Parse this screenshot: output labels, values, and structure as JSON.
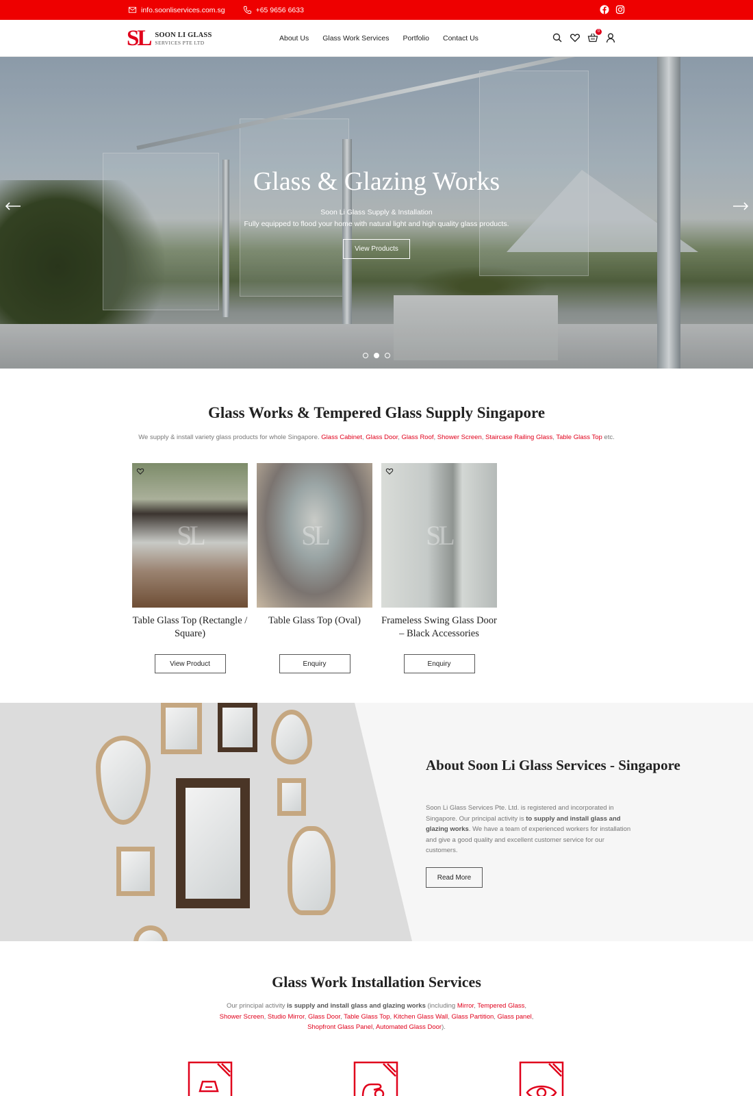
{
  "topbar": {
    "email": "info.soonliservices.com.sg",
    "phone": "+65 9656 6633",
    "social": [
      "facebook-icon",
      "instagram-icon"
    ]
  },
  "header": {
    "logo_mark": "SL",
    "logo_line1": "SOON LI GLASS",
    "logo_line2": "SERVICES PTE LTD",
    "nav": [
      "About Us",
      "Glass Work Services",
      "Portfolio",
      "Contact Us"
    ],
    "cart_count": "0",
    "icons": [
      "search-icon",
      "heart-icon",
      "cart-icon",
      "user-icon"
    ]
  },
  "hero": {
    "title": "Glass & Glazing Works",
    "subtitle1": "Soon Li Glass Supply & Installation",
    "subtitle2": "Fully equipped to flood your home with natural light and high quality glass products.",
    "button": "View Products",
    "slides_total": 3,
    "active_slide": 2
  },
  "products_section": {
    "title": "Glass Works & Tempered Glass Supply Singapore",
    "desc_prefix": "We supply & install variety glass products for whole Singapore.",
    "links": [
      "Glass Cabinet",
      "Glass Door",
      "Glass Roof",
      "Shower Screen",
      "Staircase Railing Glass",
      "Table Glass Top"
    ],
    "desc_suffix": "etc.",
    "products": [
      {
        "name": "Table Glass Top (Rectangle / Square)",
        "button": "View Product"
      },
      {
        "name": "Table Glass Top (Oval)",
        "button": "Enquiry"
      },
      {
        "name": "Frameless Swing Glass Door – Black Accessories",
        "button": "Enquiry"
      }
    ],
    "watermark": "SL"
  },
  "about": {
    "title": "About Soon Li Glass Services - Singapore",
    "text_part1": "Soon Li Glass Services Pte. Ltd. is registered and incorporated in Singapore. Our principal activity is ",
    "text_bold": "to supply and install glass and glazing works",
    "text_part2": ". We have a team of experienced workers for installation and give a good quality and excellent customer service for our customers.",
    "button": "Read More"
  },
  "installation": {
    "title": "Glass Work Installation Services",
    "desc_prefix": "Our principal activity ",
    "desc_bold": "is supply and install glass and glazing works",
    "desc_mid": " (including ",
    "links": [
      "Mirror",
      "Tempered Glass",
      "Shower Screen",
      "Studio Mirror",
      "Glass Door",
      "Table Glass Top",
      "Kitchen Glass Wall",
      "Glass Partition",
      "Glass panel",
      "Shopfront Glass Panel",
      "Automated Glass Door"
    ],
    "desc_suffix": ").",
    "service_icons": [
      "glass-supply-icon",
      "glass-install-icon",
      "glass-design-icon"
    ]
  },
  "colors": {
    "brand_red": "#ee0000",
    "link_red": "#e0001b"
  }
}
